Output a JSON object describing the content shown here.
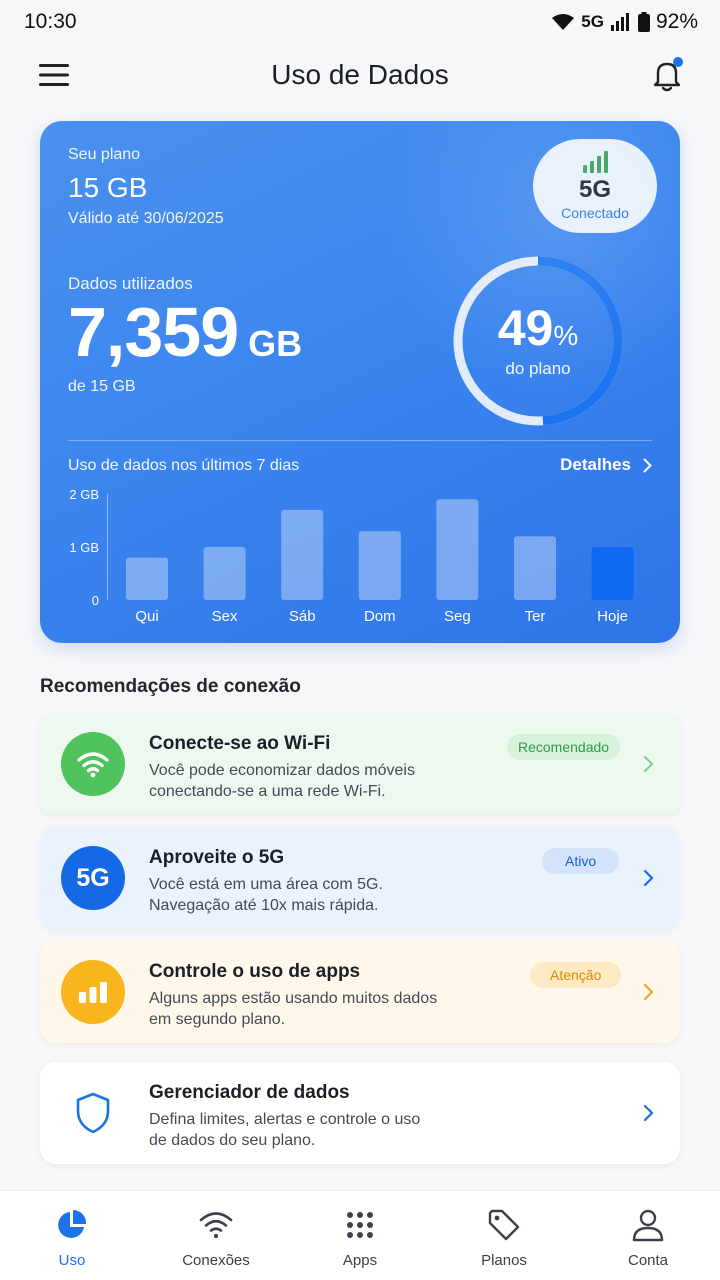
{
  "status": {
    "time": "10:30",
    "network": "5G",
    "battery": "92%"
  },
  "header": {
    "title": "Uso de Dados"
  },
  "plan": {
    "label": "Seu plano",
    "size": "15 GB",
    "valid": "Válido até 30/06/2025",
    "badge_network": "5G",
    "badge_status": "Conectado",
    "used_label": "Dados utilizados",
    "used_value": "7,359",
    "used_unit": "GB",
    "of_total": "de 15 GB",
    "percent": "49",
    "percent_sign": "%",
    "percent_fraction": 0.49,
    "percent_sub": "do plano",
    "week_label": "Uso de dados nos últimos 7 dias",
    "details_label": "Detalhes"
  },
  "chart_data": {
    "type": "bar",
    "categories": [
      "Qui",
      "Sex",
      "Sáb",
      "Dom",
      "Seg",
      "Ter",
      "Hoje"
    ],
    "values": [
      0.8,
      1.0,
      1.7,
      1.3,
      1.9,
      1.2,
      1.0
    ],
    "ylim": [
      0,
      2
    ],
    "yticks": [
      {
        "v": 2,
        "label": "2 GB"
      },
      {
        "v": 1,
        "label": "1 GB"
      },
      {
        "v": 0,
        "label": "0"
      }
    ],
    "highlight_index": 6,
    "grid": false
  },
  "recommendations": {
    "title": "Recomendações de conexão",
    "items": [
      {
        "title": "Conecte-se ao Wi-Fi",
        "line1": "Você pode economizar dados móveis",
        "line2": "conectando-se a uma rede Wi-Fi.",
        "tag": "Recomendado",
        "icon_text": ""
      },
      {
        "title": "Aproveite o 5G",
        "line1": "Você está em uma área com 5G.",
        "line2": "Navegação até 10x mais rápida.",
        "tag": "Ativo",
        "icon_text": "5G"
      },
      {
        "title": "Controle o uso de apps",
        "line1": "Alguns apps estão usando muitos dados",
        "line2": "em segundo plano.",
        "tag": "Atenção",
        "icon_text": ""
      },
      {
        "title": "Gerenciador de dados",
        "line1": "Defina limites, alertas e controle o uso",
        "line2": "de dados do seu plano.",
        "tag": "",
        "icon_text": ""
      }
    ]
  },
  "tabs": [
    {
      "label": "Uso",
      "icon": "pie-chart-icon"
    },
    {
      "label": "Conexões",
      "icon": "wifi-icon"
    },
    {
      "label": "Apps",
      "icon": "apps-grid-icon"
    },
    {
      "label": "Planos",
      "icon": "tag-icon"
    },
    {
      "label": "Conta",
      "icon": "user-icon"
    }
  ],
  "colors": {
    "accent": "#1a73e8",
    "card": "#3c86ef",
    "green": "#4fc35e",
    "orange": "#f8b51d",
    "blue_icon": "#1669e6"
  }
}
